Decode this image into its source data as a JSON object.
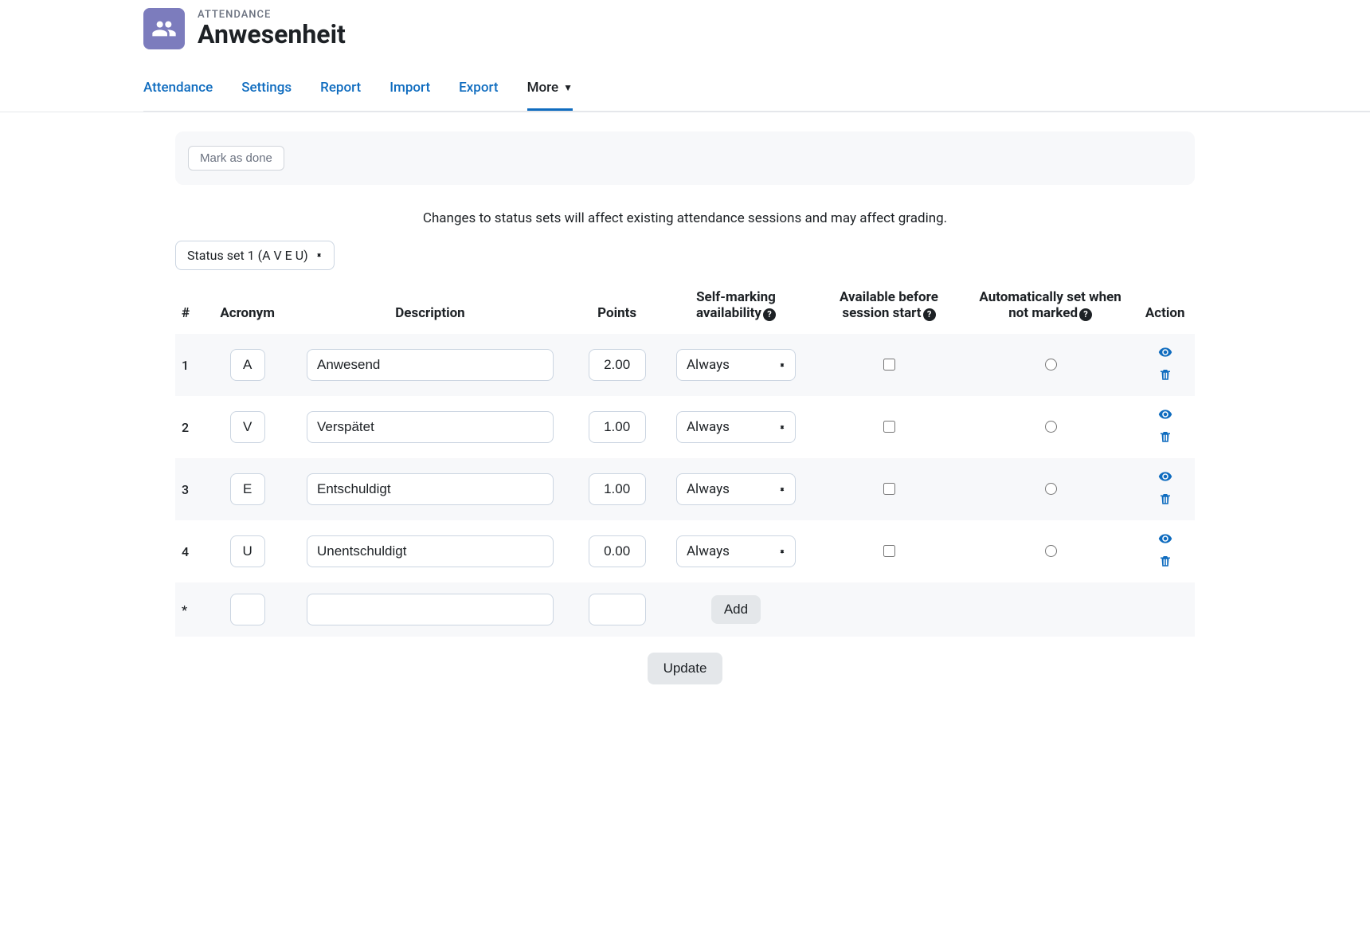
{
  "header": {
    "category": "ATTENDANCE",
    "title": "Anwesenheit"
  },
  "tabs": {
    "attendance": "Attendance",
    "settings": "Settings",
    "report": "Report",
    "import": "Import",
    "export": "Export",
    "more": "More"
  },
  "completion": {
    "mark_done": "Mark as done"
  },
  "warning": "Changes to status sets will affect existing attendance sessions and may affect grading.",
  "statusset_select": "Status set 1 (A V E U)",
  "columns": {
    "num": "#",
    "acronym": "Acronym",
    "description": "Description",
    "points": "Points",
    "self": "Self-marking availability",
    "before": "Available before session start",
    "auto": "Automatically set when not marked",
    "action": "Action"
  },
  "self_option": "Always",
  "rows": [
    {
      "num": "1",
      "acronym": "A",
      "description": "Anwesend",
      "points": "2.00"
    },
    {
      "num": "2",
      "acronym": "V",
      "description": "Verspätet",
      "points": "1.00"
    },
    {
      "num": "3",
      "acronym": "E",
      "description": "Entschuldigt",
      "points": "1.00"
    },
    {
      "num": "4",
      "acronym": "U",
      "description": "Unentschuldigt",
      "points": "0.00"
    }
  ],
  "new_row_marker": "*",
  "buttons": {
    "add": "Add",
    "update": "Update"
  }
}
